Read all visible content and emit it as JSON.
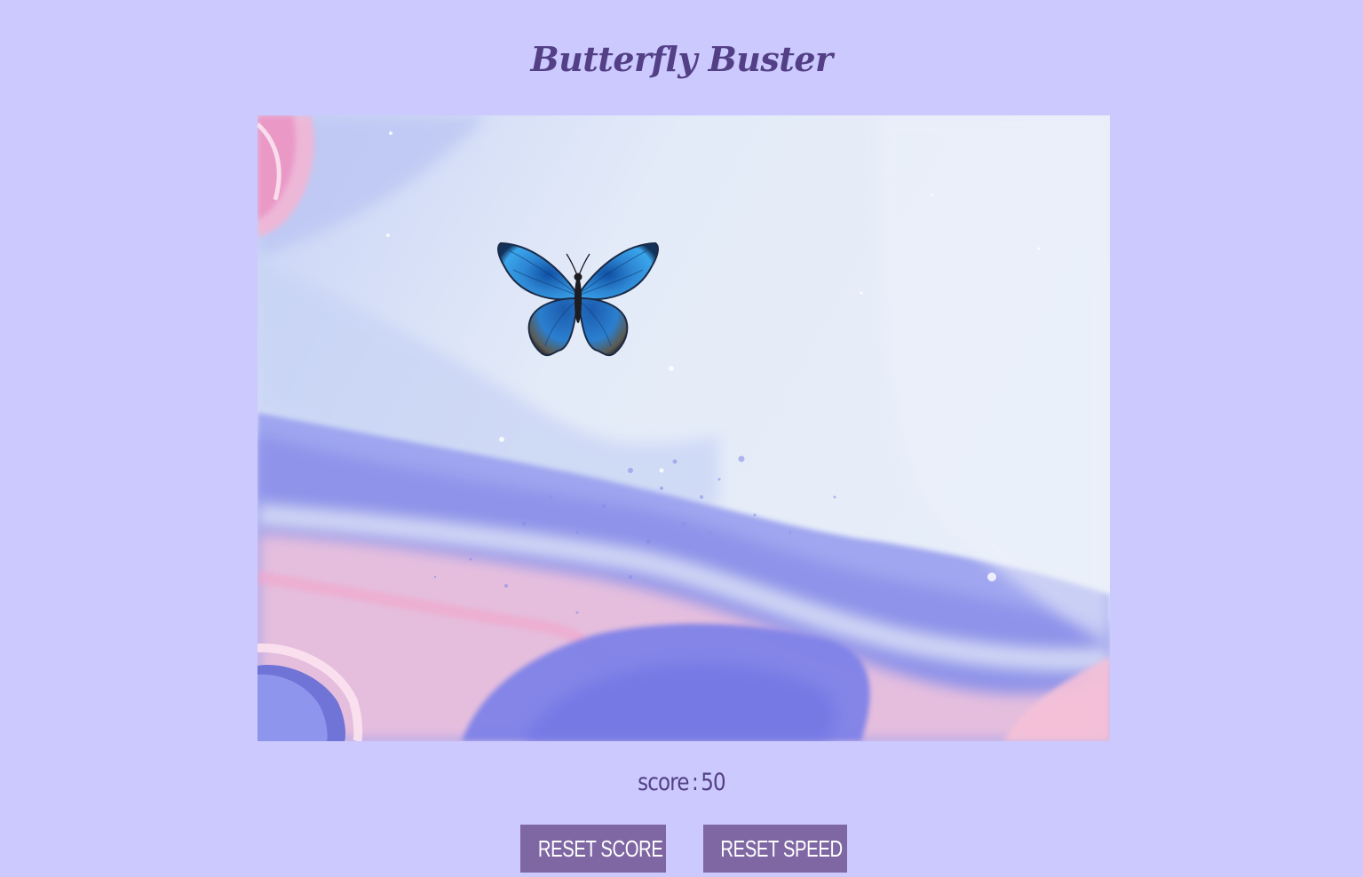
{
  "game": {
    "title": "Butterfly Buster"
  },
  "board": {
    "target_icon": "butterfly-icon",
    "colors": {
      "page_background": "#cbc9fd",
      "title_text": "#533f85",
      "button_background": "#7e67a3",
      "button_text": "#ffffff",
      "butterfly_wing": "#2d86d3"
    }
  },
  "score": {
    "label": "score",
    "separator": ":",
    "value": "50"
  },
  "controls": {
    "reset_score_label": "RESET SCORE",
    "reset_speed_label": "RESET SPEED"
  }
}
